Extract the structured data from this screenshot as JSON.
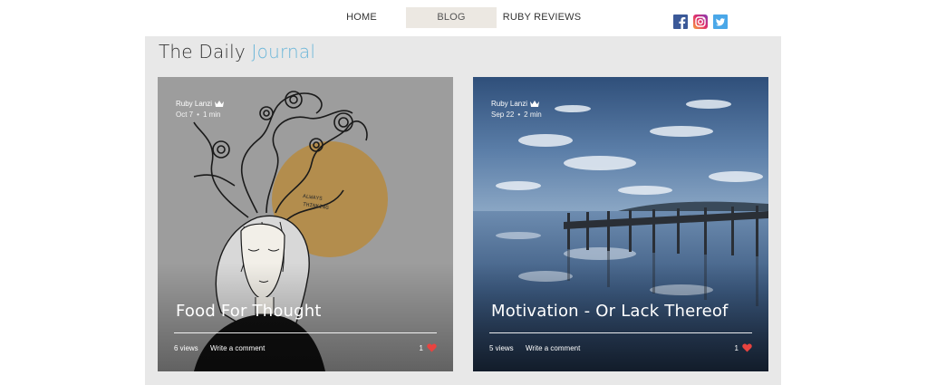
{
  "nav": {
    "items": [
      {
        "label": "HOME"
      },
      {
        "label": "BLOG"
      },
      {
        "label": "RUBY REVIEWS"
      }
    ]
  },
  "social": {
    "icons": [
      "facebook-icon",
      "instagram-icon",
      "twitter-icon"
    ],
    "colors": {
      "facebook": "#3b5998",
      "instagram": "#c13584",
      "twitter": "#4aa7e8"
    }
  },
  "blog": {
    "title_main": "The Daily",
    "title_accent": "Journal",
    "accent_color": "#6bb6d9"
  },
  "posts": [
    {
      "author": "Ruby Lanzi",
      "date": "Oct 7",
      "read_time": "1 min",
      "title": "Food For Thought",
      "views": "6 views",
      "comment_label": "Write a comment",
      "likes": "1",
      "image_text": "ALWAYS THINKING"
    },
    {
      "author": "Ruby Lanzi",
      "date": "Sep 22",
      "read_time": "2 min",
      "title": "Motivation - Or Lack Thereof",
      "views": "5 views",
      "comment_label": "Write a comment",
      "likes": "1"
    }
  ],
  "colors": {
    "heart": "#e8433f",
    "panel": "#e8e8e8",
    "nav_active": "#ece8e2"
  }
}
